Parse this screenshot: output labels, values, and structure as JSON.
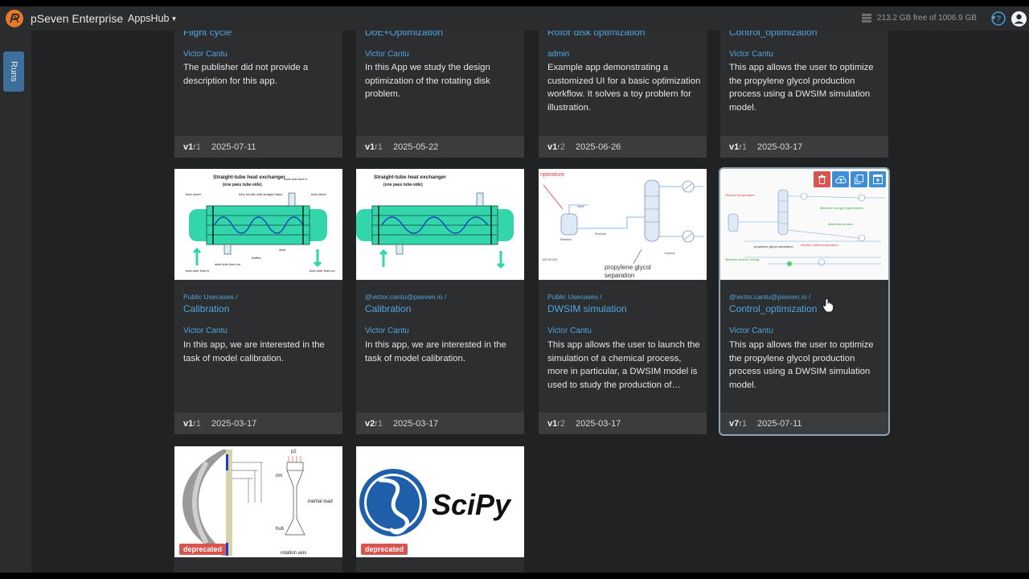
{
  "header": {
    "brand": "pSeven Enterprise",
    "menu_label": "AppsHub",
    "storage_text": "213.2 GB free of 1006.9 GB"
  },
  "sidebar": {
    "runs_label": "Runs"
  },
  "cards": [
    {
      "crumb": "",
      "title": "Flight cycle",
      "author": "Victor Cantu",
      "description": "The publisher did not provide a description for this app.",
      "version": "v1",
      "revision": "r1",
      "date": "2025-07-11"
    },
    {
      "crumb": "",
      "title": "DoE+Optimization",
      "author": "Victor Cantu",
      "description": "In this App we study the design optimization of the rotating disk problem.",
      "version": "v1",
      "revision": "r1",
      "date": "2025-05-22"
    },
    {
      "crumb": "",
      "title": "Rotor disk optimization",
      "author": "admin",
      "description": "Example app demonstrating a customized UI for a basic optimization workflow. It solves a toy problem for illustration.",
      "version": "v1",
      "revision": "r2",
      "date": "2025-06-26"
    },
    {
      "crumb": "",
      "title": "Control_optimization",
      "author": "Victor Cantu",
      "description": "This app allows the user to optimize the propylene glycol production process using a DWSIM simulation model.",
      "version": "v1",
      "revision": "r1",
      "date": "2025-03-17"
    },
    {
      "crumb": "Public Usecases /",
      "title": "Calibration",
      "author": "Victor Cantu",
      "description": "In this app, we are interested in the task of model calibration.",
      "version": "v1",
      "revision": "r1",
      "date": "2025-03-17",
      "thumb_text": {
        "title": "Straight-tube heat exchanger",
        "subtitle": "(one pass tube-side)",
        "labels": [
          "tube sheet",
          "shell-side fluid in",
          "tube bundle with straight tubes",
          "tube sheet",
          "tube-side fluid in",
          "shell-side fluid out",
          "baffles",
          "shell",
          "tube-side fluid out"
        ]
      }
    },
    {
      "crumb": "@victor.cantu@pseven.io /",
      "title": "Calibration",
      "author": "Victor Cantu",
      "description": "In this app, we are interested in the task of model calibration.",
      "version": "v2",
      "revision": "r1",
      "date": "2025-03-17",
      "thumb_text": {
        "title": "Straight-tube heat exchanger",
        "subtitle": "(one pass tube-side)"
      }
    },
    {
      "crumb": "Public Usecases /",
      "title": "DWSIM simulation",
      "author": "Victor Cantu",
      "description": "This app allows the user to launch the simulation of a chemical process, more in particular, a DWSIM model is used to study the production of propylene glycol.",
      "version": "v1",
      "revision": "r2",
      "date": "2025-03-17",
      "thumb_text": {
        "temp": "nperature",
        "vent": "Vent",
        "reactor": "Reactor",
        "product": "Product",
        "column": "Column",
        "power": "182.50 kW",
        "pg": "propylene glycol",
        "sep": "separation"
      }
    },
    {
      "crumb": "@victor.cantu@pseven.io /",
      "title": "Control_optimization",
      "author": "Victor Cantu",
      "description": "This app allows the user to optimize the propylene glycol production process using a DWSIM simulation model.",
      "version": "v7",
      "revision": "r1",
      "date": "2025-07-11",
      "thumb_text": {
        "reactor_temp": "Reactor temperature",
        "min_energy_req": "Minimize energy requirements",
        "max_product": "Maximize product",
        "pg_sep": "propylene glycol separation",
        "reboiler": "reboiler outlet temperature",
        "min_reactor": "Minimize reactor energy"
      }
    },
    {
      "badge": "deprecated",
      "thumb_text": {
        "p2": "p2",
        "rim": "rim",
        "inertial": "inertial load",
        "hub": "hub",
        "axis": "rotation axis"
      }
    },
    {
      "badge": "deprecated",
      "thumb_text": {
        "scipy": "SciPy"
      }
    }
  ],
  "selected_card_actions": [
    "delete-icon",
    "cloud-upload-icon",
    "copy-icon",
    "open-icon"
  ],
  "colors": {
    "accent": "#4fa6e0",
    "danger": "#d9534f",
    "action_blue": "#3d8ed6",
    "runs_tab": "#3d6f9c"
  }
}
